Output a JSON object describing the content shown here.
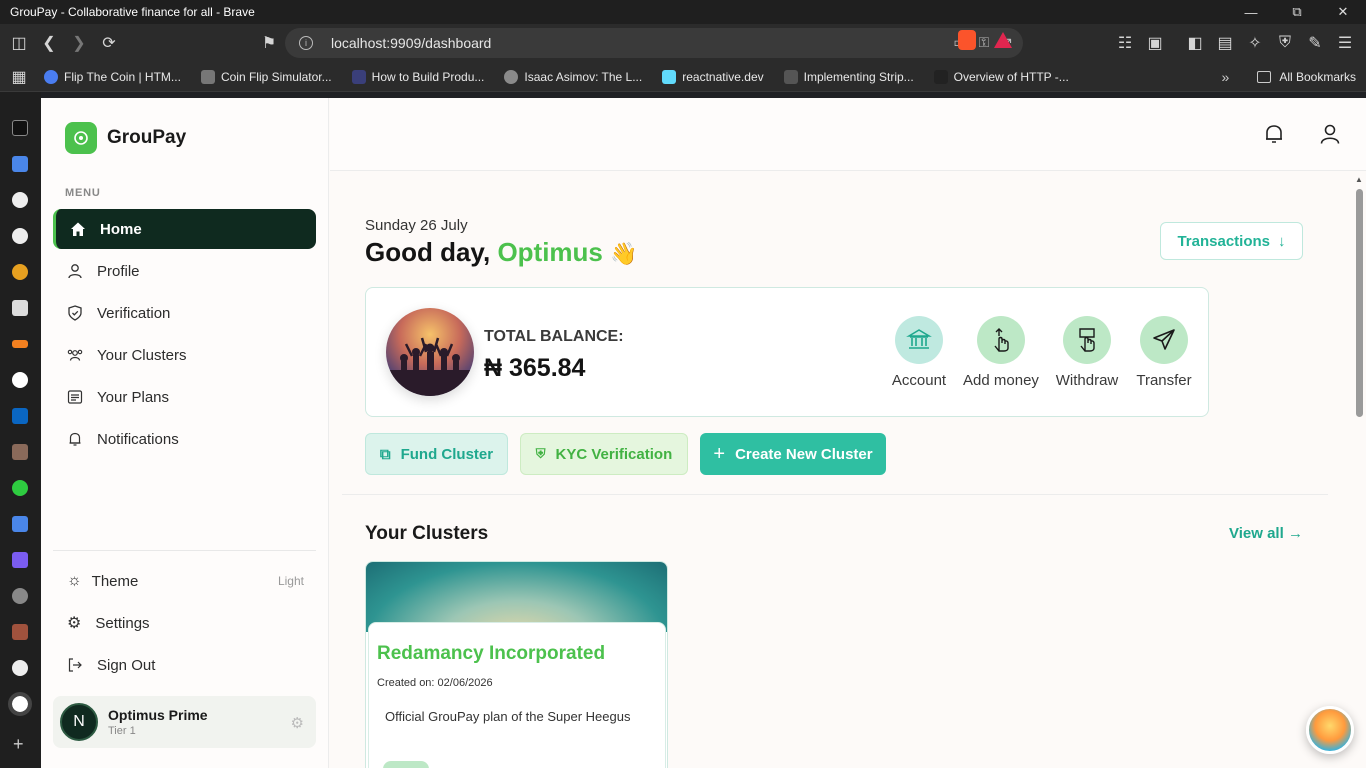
{
  "browser": {
    "window_title": "GrouPay - Collaborative finance for all - Brave",
    "url": "localhost:9909/dashboard",
    "bookmarks": [
      {
        "label": "Flip The Coin | HTM...",
        "color": "#4a7df0"
      },
      {
        "label": "Coin Flip Simulator...",
        "color": "#777777"
      },
      {
        "label": "How to Build Produ...",
        "color": "#3a3f7a"
      },
      {
        "label": "Isaac Asimov: The L...",
        "color": "#8a8a8a"
      },
      {
        "label": "reactnative.dev",
        "color": "#61dafb"
      },
      {
        "label": "Implementing Strip...",
        "color": "#555555"
      },
      {
        "label": "Overview of HTTP -...",
        "color": "#222222"
      }
    ],
    "all_bookmarks_label": "All Bookmarks"
  },
  "app": {
    "brand": "GrouPay",
    "menu_title": "MENU",
    "nav": [
      {
        "label": "Home",
        "icon": "home-icon"
      },
      {
        "label": "Profile",
        "icon": "user-icon"
      },
      {
        "label": "Verification",
        "icon": "shield-check-icon"
      },
      {
        "label": "Your Clusters",
        "icon": "users-icon"
      },
      {
        "label": "Your Plans",
        "icon": "list-icon"
      },
      {
        "label": "Notifications",
        "icon": "bell-icon"
      }
    ],
    "bottom": {
      "theme_label": "Theme",
      "theme_value": "Light",
      "settings_label": "Settings",
      "signout_label": "Sign Out"
    },
    "user": {
      "initial": "N",
      "name": "Optimus Prime",
      "tier": "Tier 1"
    }
  },
  "dashboard": {
    "date": "Sunday 26 July",
    "greeting": "Good day,",
    "user_first": "Optimus",
    "wave": "👋",
    "transactions_label": "Transactions",
    "balance_label": "TOTAL BALANCE:",
    "balance_amount": "₦ 365.84",
    "actions": [
      {
        "label": "Account",
        "icon": "bank-icon"
      },
      {
        "label": "Add money",
        "icon": "add-money-icon"
      },
      {
        "label": "Withdraw",
        "icon": "withdraw-icon"
      },
      {
        "label": "Transfer",
        "icon": "send-icon"
      }
    ],
    "quick": {
      "fund": "Fund Cluster",
      "kyc": "KYC Verification",
      "create": "Create New Cluster"
    },
    "clusters_title": "Your Clusters",
    "view_all": "View all",
    "cluster": {
      "name": "Redamancy Incorporated",
      "created": "Created on: 02/06/2026",
      "description": "Official GrouPay plan of the Super Heegus"
    }
  },
  "colors": {
    "brand_green": "#4cc14d",
    "teal": "#1fa88e",
    "active_nav": "#0f2a1f"
  }
}
